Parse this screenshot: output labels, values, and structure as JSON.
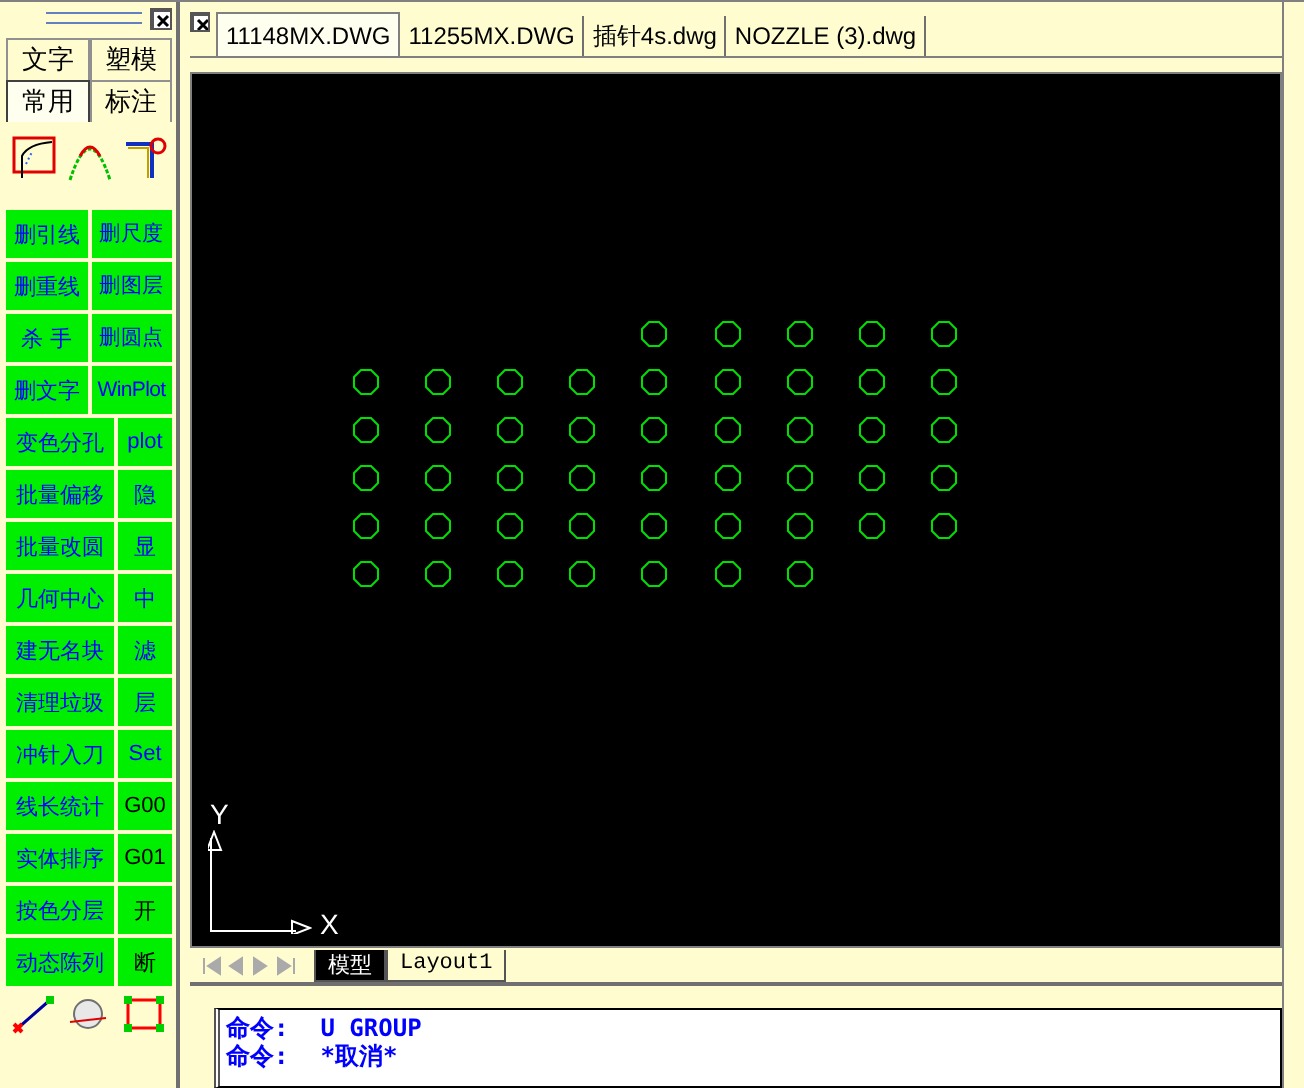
{
  "panel_tabs": [
    {
      "label": "文字",
      "selected": false
    },
    {
      "label": "塑模",
      "selected": false
    },
    {
      "label": "常用",
      "selected": true
    },
    {
      "label": "标注",
      "selected": false
    }
  ],
  "tool_buttons": [
    {
      "label": "删引线",
      "dark": false,
      "kind": "pair"
    },
    {
      "label": "删尺度",
      "dark": false,
      "kind": "pair"
    },
    {
      "label": "删重线",
      "dark": false,
      "kind": "pair"
    },
    {
      "label": "删图层",
      "dark": false,
      "kind": "pair"
    },
    {
      "label": "杀 手",
      "dark": false,
      "kind": "pair"
    },
    {
      "label": "删圆点",
      "dark": false,
      "kind": "pair"
    },
    {
      "label": "删文字",
      "dark": false,
      "kind": "pair"
    },
    {
      "label": "WinPlot",
      "dark": false,
      "kind": "pair"
    },
    {
      "label": "变色分孔",
      "dark": false,
      "kind": "wide"
    },
    {
      "label": "plot",
      "dark": false,
      "kind": "narrow"
    },
    {
      "label": "批量偏移",
      "dark": false,
      "kind": "wide"
    },
    {
      "label": "隐",
      "dark": false,
      "kind": "narrow"
    },
    {
      "label": "批量改圆",
      "dark": false,
      "kind": "wide"
    },
    {
      "label": "显",
      "dark": false,
      "kind": "narrow"
    },
    {
      "label": "几何中心",
      "dark": false,
      "kind": "wide"
    },
    {
      "label": "中",
      "dark": false,
      "kind": "narrow"
    },
    {
      "label": "建无名块",
      "dark": false,
      "kind": "wide"
    },
    {
      "label": "滤",
      "dark": false,
      "kind": "narrow"
    },
    {
      "label": "清理垃圾",
      "dark": false,
      "kind": "wide"
    },
    {
      "label": "层",
      "dark": false,
      "kind": "narrow"
    },
    {
      "label": "冲针入刀",
      "dark": false,
      "kind": "wide"
    },
    {
      "label": "Set",
      "dark": false,
      "kind": "narrow"
    },
    {
      "label": "线长统计",
      "dark": false,
      "kind": "wide"
    },
    {
      "label": "G00",
      "dark": true,
      "kind": "narrow"
    },
    {
      "label": "实体排序",
      "dark": false,
      "kind": "wide"
    },
    {
      "label": "G01",
      "dark": true,
      "kind": "narrow"
    },
    {
      "label": "按色分层",
      "dark": false,
      "kind": "wide"
    },
    {
      "label": "开",
      "dark": true,
      "kind": "narrow"
    },
    {
      "label": "动态陈列",
      "dark": false,
      "kind": "wide"
    },
    {
      "label": "断",
      "dark": true,
      "kind": "narrow"
    }
  ],
  "file_tabs": [
    {
      "label": "11148MX.DWG",
      "selected": true
    },
    {
      "label": "11255MX.DWG",
      "selected": false
    },
    {
      "label": "插针4s.dwg",
      "selected": false
    },
    {
      "label": "NOZZLE (3).dwg",
      "selected": false
    }
  ],
  "ucs": {
    "x_label": "X",
    "y_label": "Y"
  },
  "layout_tabs": [
    {
      "label": "模型",
      "selected": true
    },
    {
      "label": "Layout1",
      "selected": false
    }
  ],
  "command_lines": [
    {
      "prompt": "命令:",
      "text": "U GROUP"
    },
    {
      "prompt": "命令:",
      "text": "*取消*"
    }
  ]
}
